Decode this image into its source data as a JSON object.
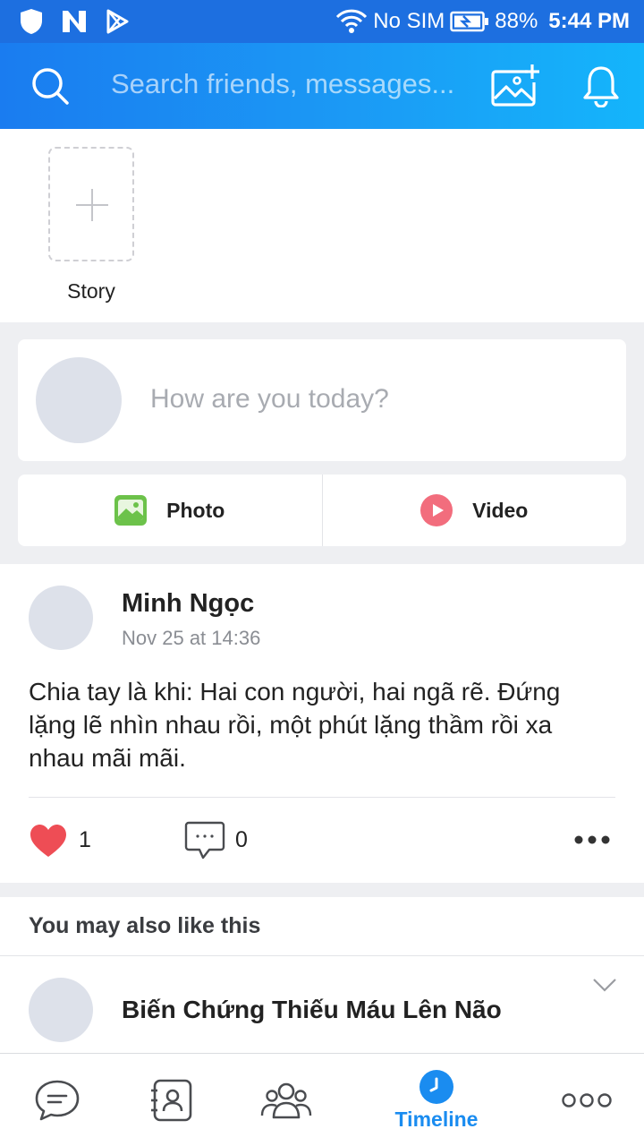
{
  "status_bar": {
    "carrier": "No SIM",
    "battery": "88%",
    "time": "5:44 PM"
  },
  "header": {
    "search_placeholder": "Search friends, messages..."
  },
  "story": {
    "label": "Story"
  },
  "composer": {
    "prompt": "How are you today?",
    "photo_label": "Photo",
    "video_label": "Video"
  },
  "post": {
    "author": "Minh Ngọc",
    "time": "Nov 25 at 14:36",
    "text": "Chia tay là khi: Hai con người, hai ngã rẽ. Đứng lặng lẽ nhìn nhau rồi, một phút lặng thầm rồi xa nhau mãi mãi.",
    "likes": "1",
    "comments": "0"
  },
  "suggestions": {
    "header": "You may also like this",
    "items": [
      {
        "title": "Biến Chứng Thiếu Máu Lên Não"
      }
    ]
  },
  "bottom_nav": {
    "items": [
      {
        "icon": "chat-icon",
        "label": ""
      },
      {
        "icon": "contacts-icon",
        "label": ""
      },
      {
        "icon": "groups-icon",
        "label": ""
      },
      {
        "icon": "timeline-icon",
        "label": "Timeline",
        "active": true
      },
      {
        "icon": "more-icon",
        "label": ""
      }
    ]
  },
  "colors": {
    "header_gradient_start": "#1a7cf0",
    "header_gradient_end": "#14b5fb",
    "accent": "#1a8cf0",
    "like": "#ee4d55"
  }
}
